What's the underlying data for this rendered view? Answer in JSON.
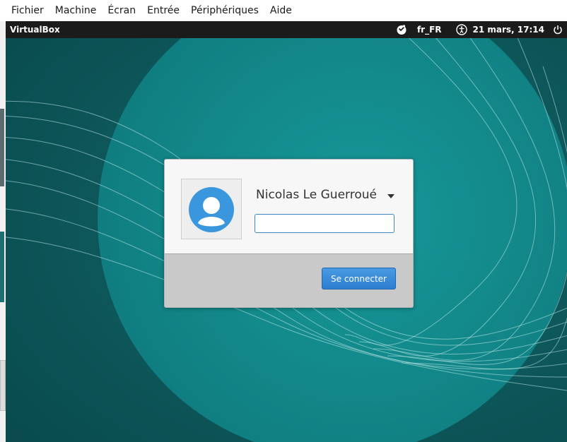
{
  "host_menubar": {
    "items": [
      "Fichier",
      "Machine",
      "Écran",
      "Entrée",
      "Périphériques",
      "Aide"
    ]
  },
  "top_bar": {
    "title": "VirtualBox",
    "language": "fr_FR",
    "clock": "21 mars, 17:14",
    "icons": [
      "tweaks-icon",
      "accessibility-icon",
      "power-icon"
    ]
  },
  "login": {
    "user_name": "Nicolas Le Guerroué",
    "password_value": "",
    "connect_label": "Se connecter"
  },
  "colors": {
    "top_bar_bg": "#1b1b1b",
    "wallpaper_dark": "#0c5a5c",
    "wallpaper_circle": "#138a8a",
    "button_blue": "#3a8bd8"
  }
}
